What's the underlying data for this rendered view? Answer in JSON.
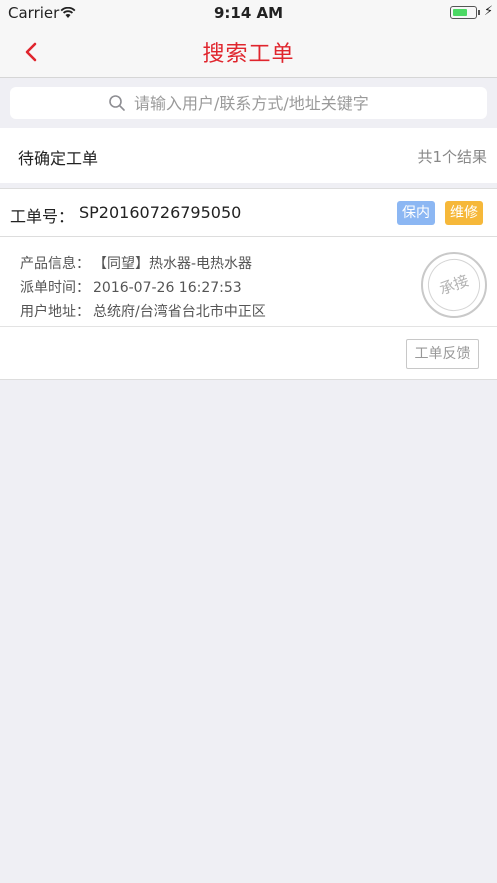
{
  "status_bar": {
    "carrier": "Carrier",
    "time": "9:14 AM"
  },
  "nav": {
    "title": "搜索工单",
    "accent_color": "#e0252d"
  },
  "search": {
    "placeholder": "请输入用户/联系方式/地址关键字"
  },
  "section": {
    "label": "待确定工单",
    "result_count": "共1个结果"
  },
  "order": {
    "number_label": "工单号：",
    "number": "SP20160726795050",
    "tags": [
      "保内",
      "维修"
    ],
    "fields": [
      {
        "key": "产品信息：",
        "value": "【同望】热水器-电热水器"
      },
      {
        "key": "派单时间：",
        "value": "2016-07-26 16:27:53"
      },
      {
        "key": "用户地址：",
        "value": "总统府/台湾省台北市中正区"
      }
    ],
    "accept_stamp": "承接",
    "feedback_button": "工单反馈"
  }
}
